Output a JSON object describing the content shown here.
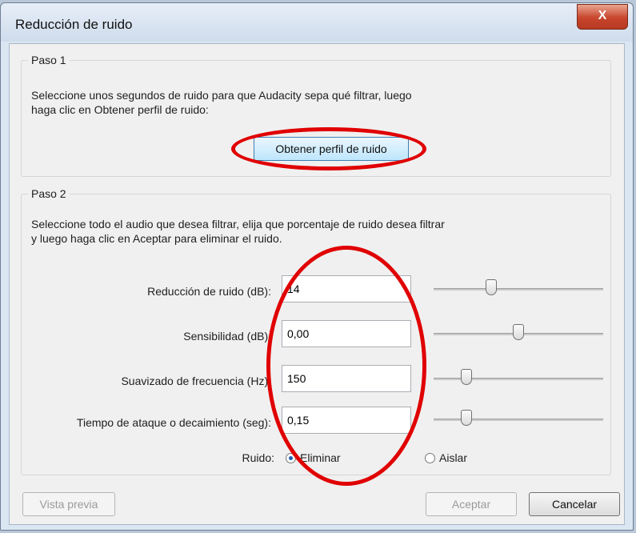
{
  "window": {
    "title": "Reducción de ruido",
    "close_icon": "X"
  },
  "step1": {
    "label": "Paso 1",
    "description_line1": "Seleccione unos segundos de ruido para que Audacity sepa qué filtrar, luego",
    "description_line2": "haga clic en Obtener perfil de ruido:",
    "profile_button": "Obtener perfil de ruido"
  },
  "step2": {
    "label": "Paso 2",
    "description_line1": "Seleccione todo el audio que desea filtrar, elija que porcentaje de ruido desea filtrar",
    "description_line2": "y luego haga clic en Aceptar para eliminar el ruido.",
    "rows": [
      {
        "label": "Reducción de ruido (dB):",
        "value": "14",
        "slider_fraction": 0.33
      },
      {
        "label": "Sensibilidad (dB):",
        "value": "0,00",
        "slider_fraction": 0.5
      },
      {
        "label": "Suavizado de frecuencia (Hz):",
        "value": "150",
        "slider_fraction": 0.17
      },
      {
        "label": "Tiempo de ataque o decaimiento (seg):",
        "value": "0,15",
        "slider_fraction": 0.17
      }
    ],
    "noise_label": "Ruido:",
    "noise_options": [
      {
        "label": "Eliminar",
        "selected": true
      },
      {
        "label": "Aislar",
        "selected": false
      }
    ]
  },
  "footer": {
    "preview_button": "Vista previa",
    "accept_button": "Aceptar",
    "cancel_button": "Cancelar"
  },
  "colors": {
    "annotation": "#e00000",
    "close_button": "#c7452b"
  }
}
